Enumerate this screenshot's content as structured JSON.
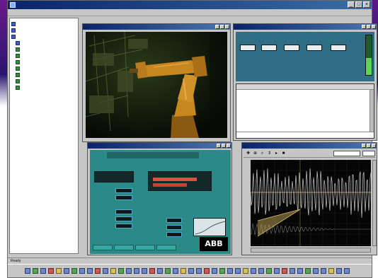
{
  "window": {
    "title": "",
    "controls": [
      "_",
      "□",
      "×"
    ]
  },
  "menu": [],
  "tree": {
    "items": [
      {
        "label": "",
        "icon": "folder-icon",
        "indent": 0
      },
      {
        "label": "",
        "icon": "folder-icon",
        "indent": 0
      },
      {
        "label": "",
        "icon": "folder-icon",
        "indent": 0
      },
      {
        "label": "",
        "icon": "folder-icon",
        "indent": 1
      },
      {
        "label": "",
        "icon": "robot-icon",
        "indent": 1
      },
      {
        "label": "",
        "icon": "robot-icon",
        "indent": 1
      },
      {
        "label": "",
        "icon": "robot-icon",
        "indent": 1
      },
      {
        "label": "",
        "icon": "robot-icon",
        "indent": 1
      },
      {
        "label": "",
        "icon": "robot-icon",
        "indent": 1
      },
      {
        "label": "",
        "icon": "robot-icon",
        "indent": 1
      },
      {
        "label": "",
        "icon": "robot-icon",
        "indent": 1
      }
    ]
  },
  "event_log": {
    "columns": [
      "",
      "",
      "",
      ""
    ],
    "rows": [
      [
        "",
        "",
        "",
        ""
      ],
      [
        "",
        "",
        "",
        ""
      ],
      [
        "",
        "",
        "",
        ""
      ],
      [
        "",
        "",
        "",
        ""
      ],
      [
        "",
        "",
        "",
        ""
      ],
      [
        "",
        "",
        "",
        ""
      ],
      [
        "",
        "",
        "",
        ""
      ],
      [
        "",
        "",
        "",
        ""
      ]
    ]
  },
  "operator_panel": {
    "header": "",
    "logo": "ABB"
  },
  "scope": {
    "toolbar_icons": [
      "cursor-icon",
      "crosshair-icon",
      "zoom-icon",
      "scale-icon",
      "arrow-icon",
      "record-icon"
    ]
  },
  "status": {
    "text": "Ready"
  },
  "colors": {
    "titlebar": "#0a246a",
    "panel_teal": "#2a8a88",
    "status_blue": "#2e6f86",
    "robot_orange": "#c8861e",
    "scope_trace": "#e8e8e8",
    "scope_trace_yellow": "#d8b860"
  }
}
